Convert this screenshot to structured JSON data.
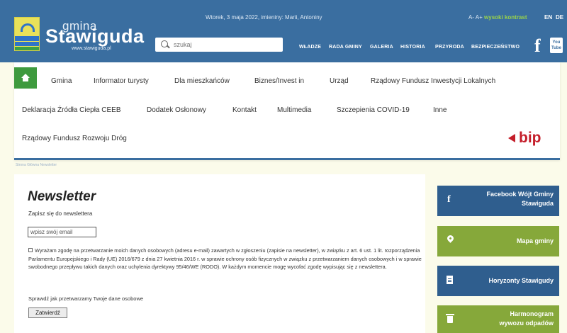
{
  "header": {
    "logo": {
      "gmina": "gmina",
      "name": "Stawiguda",
      "url": "www.stawiguda.pl"
    },
    "date_line": "Wtorek, 3 maja 2022, imieniny: Marii, Antoniny",
    "a11y": {
      "font_small": "A-",
      "font_large": "A+",
      "contrast": "wysoki kontrast"
    },
    "languages": [
      "EN",
      "DE"
    ],
    "search": {
      "placeholder": "szukaj"
    },
    "topnav": [
      "WŁADZE",
      "RADA GMINY",
      "GALERIA",
      "HISTORIA",
      "PRZYRODA",
      "BEZPIECZEŃSTWO"
    ],
    "social": {
      "facebook": "f",
      "youtube_top": "You",
      "youtube_bottom": "Tube"
    }
  },
  "menu": {
    "row1": [
      "Gmina",
      "Informator turysty",
      "Dla mieszkańców",
      "Biznes/Invest in",
      "Urząd",
      "Rządowy Fundusz Inwestycji Lokalnych"
    ],
    "row2": [
      "Deklaracja Źródła Ciepła CEEB",
      "Dodatek Osłonowy",
      "Kontakt",
      "Multimedia",
      "Szczepienia COVID-19",
      "Inne"
    ],
    "row3": [
      "Rządowy Fundusz Rozwoju Dróg"
    ],
    "bip": "bip"
  },
  "breadcrumb": "Strona Główna  Newsletter",
  "newsletter": {
    "title": "Newsletter",
    "subtitle": "Zapisz się do newslettera",
    "email_placeholder": "wpisz swój email",
    "consent": "Wyrażam zgodę na przetwarzanie moich danych osobowych (adresu e-mail) zawartych w zgłoszeniu (zapisie na newsletter), w związku z art. 6 ust. 1 lit. rozporządzenia Parlamentu Europejskiego i Rady (UE) 2016/679 z dnia 27 kwietnia 2016 r. w sprawie ochrony osób fizycznych w związku z przetwarzaniem danych osobowych i w sprawie swobodnego przepływu takich danych oraz uchylenia dyrektywy 95/46/WE (RODO). W każdym momencie mogę wycofać zgodę wypisując się z newslettera.",
    "privacy": "Sprawdź jak przetwarzamy Twoje dane osobowe",
    "submit": "Zatwierdź"
  },
  "tiles": [
    {
      "label1": "Facebook Wójt Gminy",
      "label2": "Stawiguda",
      "icon": "facebook-icon",
      "color": "#2f5e8e"
    },
    {
      "label1": "Mapa gminy",
      "label2": "",
      "icon": "map-pin-icon",
      "color": "#86a83a"
    },
    {
      "label1": "Horyzonty Stawigudy",
      "label2": "",
      "icon": "document-icon",
      "color": "#2f5e8e"
    },
    {
      "label1": "Harmonogram",
      "label2": "wywozu odpadów",
      "icon": "trash-icon",
      "color": "#86a83a"
    }
  ],
  "colors": {
    "header": "#3a6ea0",
    "accent_green": "#3e9a3e",
    "bip_red": "#c41e2a"
  }
}
